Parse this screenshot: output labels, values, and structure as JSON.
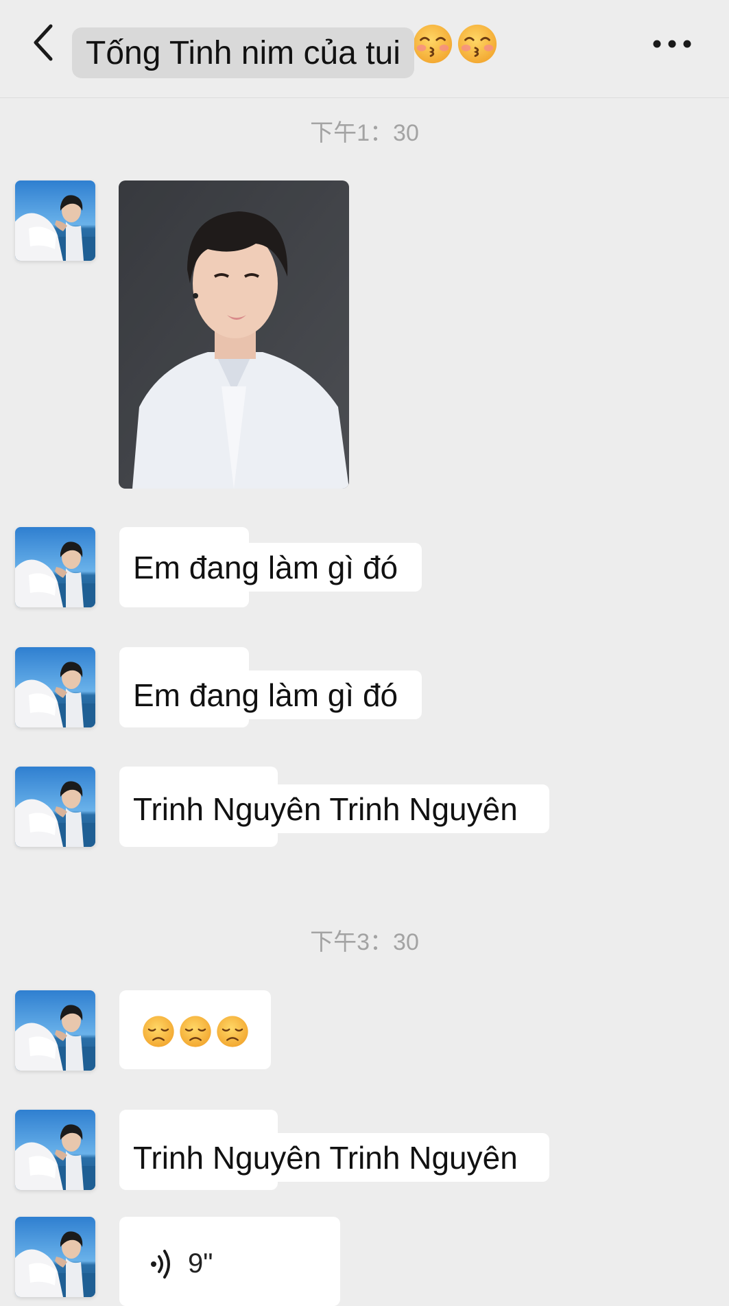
{
  "header": {
    "back_icon": "chevron-left-icon",
    "title": "Tống Tinh nim của tui",
    "title_emoji": [
      "kissing-face-emoji",
      "kissing-face-emoji"
    ],
    "more_icon": "more-dots-icon"
  },
  "timestamps": [
    "下午1：30",
    "下午3：30"
  ],
  "messages": [
    {
      "type": "image",
      "content": "selfie-photo"
    },
    {
      "type": "text",
      "text": "Em đang làm gì đó"
    },
    {
      "type": "text",
      "text": "Em đang làm gì đó"
    },
    {
      "type": "text",
      "text": "Trinh Nguyên Trinh Nguyên"
    },
    {
      "type": "emoji",
      "content": [
        "disappointed-face-emoji",
        "disappointed-face-emoji",
        "disappointed-face-emoji"
      ]
    },
    {
      "type": "text",
      "text": "Trinh Nguyên Trinh Nguyên"
    },
    {
      "type": "voice",
      "icon": "voice-wave-icon",
      "duration": "9\""
    }
  ],
  "colors": {
    "background": "#ededed",
    "bubble": "#ffffff",
    "title_pill": "#d9d9d9",
    "timestamp": "#a3a3a3"
  }
}
